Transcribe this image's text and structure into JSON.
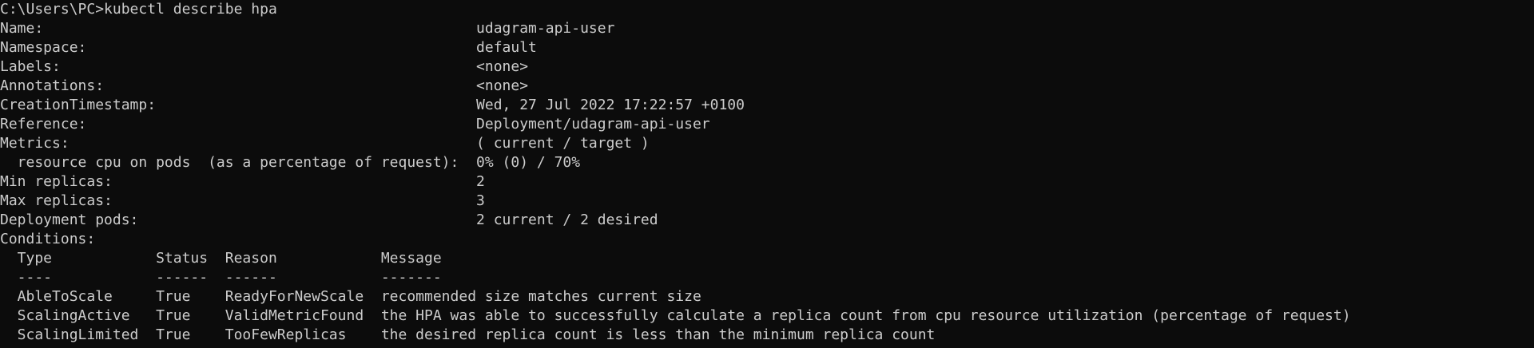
{
  "terminal": {
    "lines": [
      "C:\\Users\\PC>kubectl describe hpa",
      "Name:                                                  udagram-api-user",
      "Namespace:                                             default",
      "Labels:                                                <none>",
      "Annotations:                                           <none>",
      "CreationTimestamp:                                     Wed, 27 Jul 2022 17:22:57 +0100",
      "Reference:                                             Deployment/udagram-api-user",
      "Metrics:                                               ( current / target )",
      "  resource cpu on pods  (as a percentage of request):  0% (0) / 70%",
      "Min replicas:                                          2",
      "Max replicas:                                          3",
      "Deployment pods:                                       2 current / 2 desired",
      "Conditions:",
      "  Type            Status  Reason            Message",
      "  ----            ------  ------            -------",
      "  AbleToScale     True    ReadyForNewScale  recommended size matches current size",
      "  ScalingActive   True    ValidMetricFound  the HPA was able to successfully calculate a replica count from cpu resource utilization (percentage of request)",
      "  ScalingLimited  True    TooFewReplicas    the desired replica count is less than the minimum replica count"
    ]
  }
}
